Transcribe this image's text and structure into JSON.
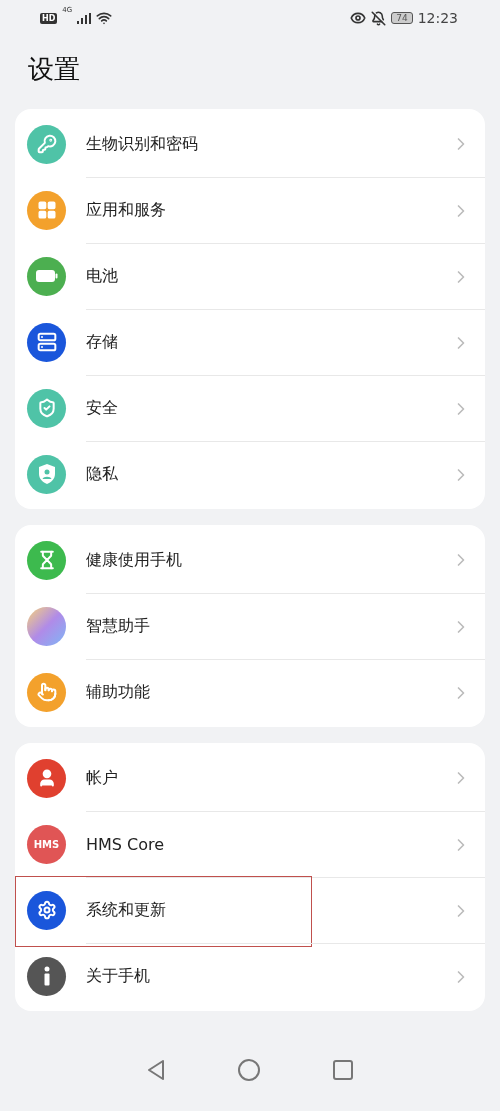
{
  "status_bar": {
    "hd_badge": "HD",
    "network": "4G",
    "battery": "74",
    "time": "12:23"
  },
  "title": "设置",
  "groups": [
    {
      "items": [
        {
          "label": "生物识别和密码",
          "kind": "key",
          "color": "#4fc3a7",
          "highlighted": false
        },
        {
          "label": "应用和服务",
          "kind": "apps",
          "color": "#f3a12c",
          "highlighted": false
        },
        {
          "label": "电池",
          "kind": "battery",
          "color": "#4caf50",
          "highlighted": false
        },
        {
          "label": "存储",
          "kind": "storage",
          "color": "#1a56db",
          "highlighted": false
        },
        {
          "label": "安全",
          "kind": "shield",
          "color": "#4fc3a7",
          "highlighted": false
        },
        {
          "label": "隐私",
          "kind": "privacy",
          "color": "#4fc3a7",
          "highlighted": false
        }
      ]
    },
    {
      "items": [
        {
          "label": "健康使用手机",
          "kind": "hourglass",
          "color": "#3dba4e",
          "highlighted": false
        },
        {
          "label": "智慧助手",
          "kind": "assistant",
          "color": "#b08be8",
          "highlighted": false
        },
        {
          "label": "辅助功能",
          "kind": "hand",
          "color": "#f3a12c",
          "highlighted": false
        }
      ]
    },
    {
      "items": [
        {
          "label": "帐户",
          "kind": "user",
          "color": "#e0402f",
          "highlighted": false
        },
        {
          "label": "HMS Core",
          "kind": "hms",
          "icon_text": "HMS",
          "color": "#e05555",
          "highlighted": false
        },
        {
          "label": "系统和更新",
          "kind": "gear",
          "color": "#1a56db",
          "highlighted": true
        },
        {
          "label": "关于手机",
          "kind": "info",
          "color": "#555555",
          "highlighted": false
        }
      ]
    }
  ]
}
